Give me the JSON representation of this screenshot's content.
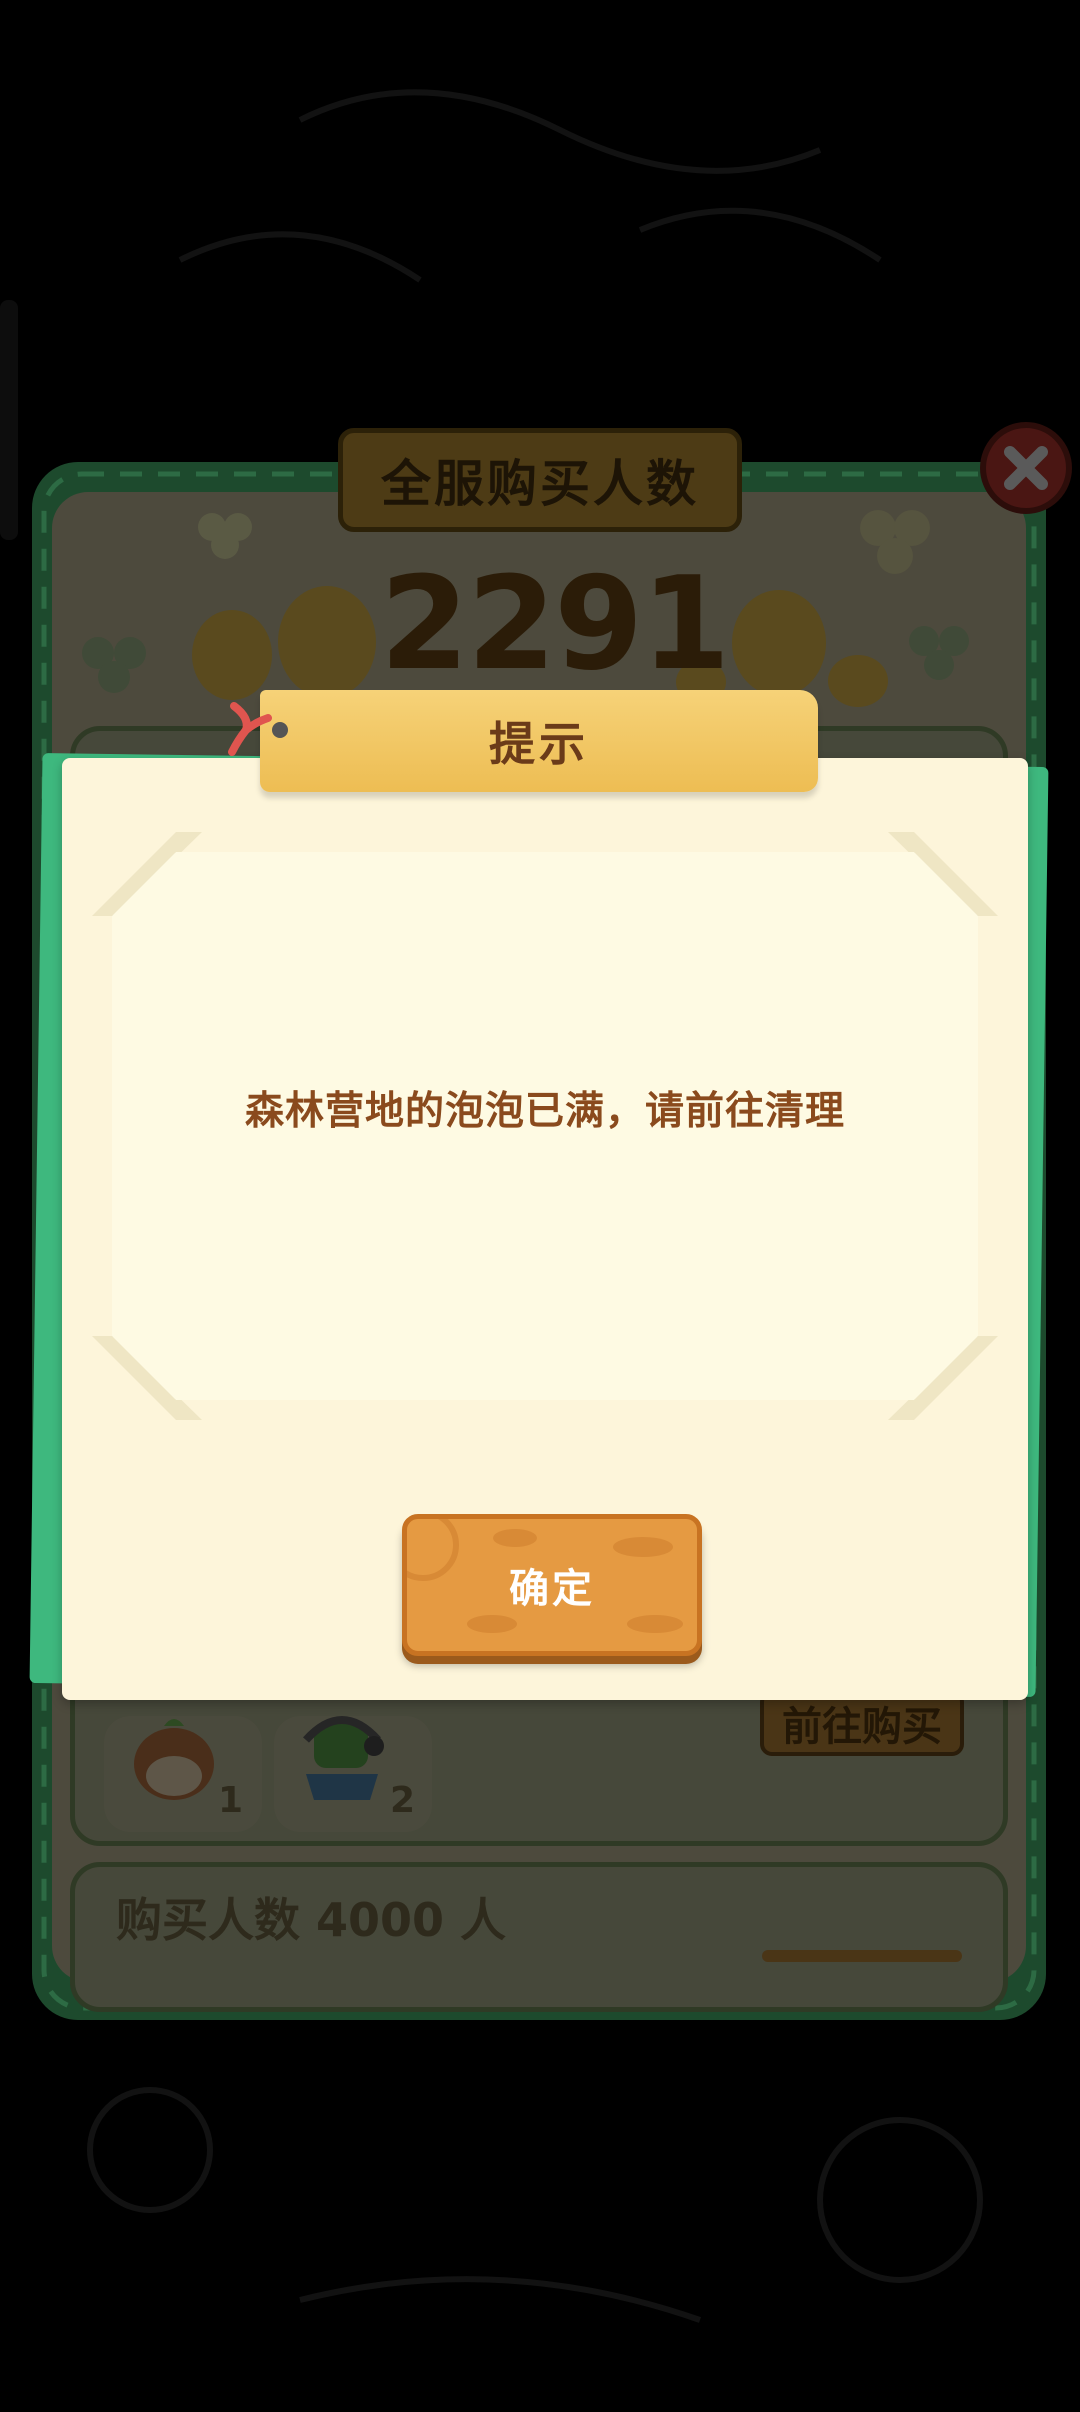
{
  "colors": {
    "overlay": "#000000",
    "panel_green": "#1d4a2d",
    "dialog_paper": "#fdf5da",
    "dialog_green_sheet": "#3eb87e",
    "header_gold": "#f2c865",
    "message_text": "#8a4a1d",
    "confirm_orange": "#e59a42"
  },
  "background_panel": {
    "title": "全服购买人数",
    "purchase_count": "2291",
    "close_icon": "close-x-icon",
    "tiers": [
      {
        "rewards": [
          {
            "icon": "chestnut-bird-icon",
            "quantity": "1"
          },
          {
            "icon": "green-monster-headphones-icon",
            "quantity": "2"
          }
        ],
        "button_label": "前往购买"
      },
      {
        "label": "购买人数 4000 人"
      }
    ]
  },
  "dialog": {
    "title": "提示",
    "message": "森林营地的泡泡已满，请前往清理",
    "confirm_label": "确定"
  }
}
